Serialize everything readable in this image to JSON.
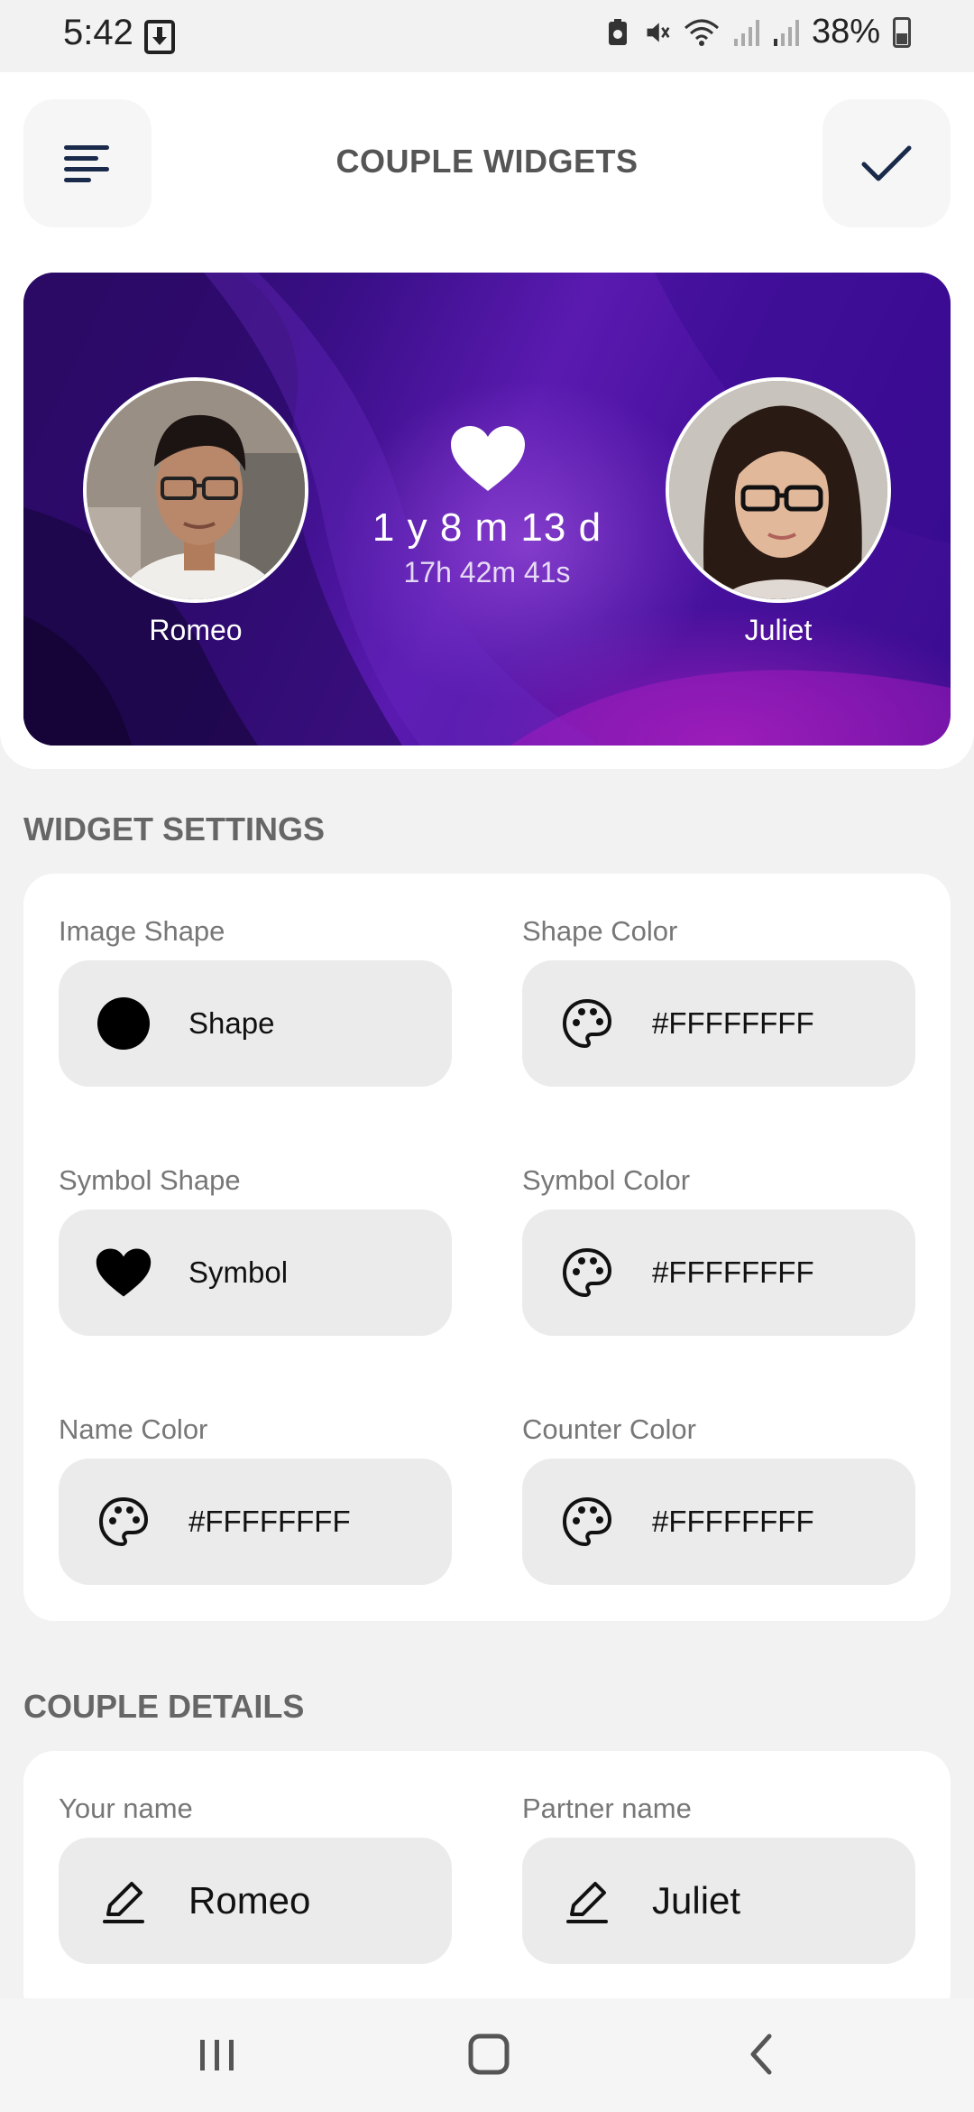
{
  "status_bar": {
    "time": "5:42",
    "battery_pct": "38%",
    "icons": [
      "download-icon",
      "battery-saver-icon",
      "mute-icon",
      "wifi-icon",
      "signal-icon",
      "signal-icon",
      "battery-icon"
    ]
  },
  "header": {
    "title": "COUPLE WIDGETS",
    "menu_icon": "menu-icon",
    "confirm_icon": "check-icon"
  },
  "preview": {
    "left_name": "Romeo",
    "right_name": "Juliet",
    "counter_main": "1 y 8 m 13 d",
    "counter_sub": "17h 42m 41s",
    "symbol_icon": "heart-icon"
  },
  "widget_settings": {
    "title": "WIDGET SETTINGS",
    "image_shape": {
      "label": "Image Shape",
      "value": "Shape"
    },
    "shape_color": {
      "label": "Shape Color",
      "value": "#FFFFFFFF"
    },
    "symbol_shape": {
      "label": "Symbol Shape",
      "value": "Symbol"
    },
    "symbol_color": {
      "label": "Symbol Color",
      "value": "#FFFFFFFF"
    },
    "name_color": {
      "label": "Name Color",
      "value": "#FFFFFFFF"
    },
    "counter_color": {
      "label": "Counter Color",
      "value": "#FFFFFFFF"
    }
  },
  "couple_details": {
    "title": "COUPLE DETAILS",
    "your_name": {
      "label": "Your name",
      "value": "Romeo"
    },
    "partner_name": {
      "label": "Partner name",
      "value": "Juliet"
    }
  },
  "nav_bar": {
    "icons": [
      "recents-icon",
      "home-icon",
      "back-icon"
    ]
  },
  "colors": {
    "accent_dark": "#1a2a4a",
    "card_bg": "#ffffff",
    "pill_bg": "#ebebeb",
    "page_bg": "#f2f2f2"
  }
}
